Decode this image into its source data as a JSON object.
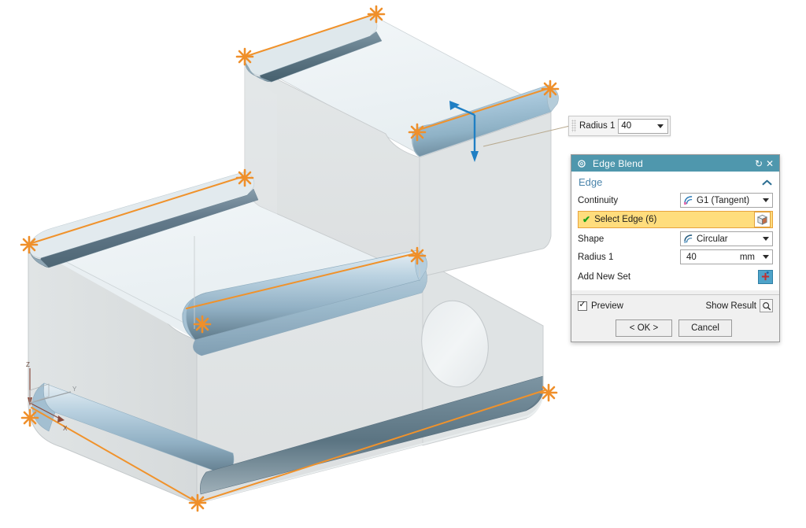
{
  "app": {
    "kind": "cad-modeling-viewport"
  },
  "float_input": {
    "label": "Radius 1",
    "value": "40",
    "dropdown_icon": "chevron-down-icon",
    "grip_icon": "drag-grip-icon"
  },
  "dialog": {
    "title": "Edge Blend",
    "title_icon": "gear-icon",
    "reset_icon": "reset-icon",
    "reset_glyph": "↻",
    "close_icon": "close-icon",
    "close_glyph": "✕",
    "group": {
      "title": "Edge",
      "collapse_icon": "chevron-up-icon"
    },
    "fields": {
      "continuity_label": "Continuity",
      "continuity_value": "G1 (Tangent)",
      "continuity_icon": "curve-continuity-icon",
      "select_edge_label": "Select Edge (6)",
      "select_edge_check": "✔",
      "select_edge_icon": "cube-select-icon",
      "shape_label": "Shape",
      "shape_value": "Circular",
      "shape_icon": "arc-shape-icon",
      "radius_label": "Radius 1",
      "radius_value": "40",
      "radius_unit": "mm",
      "add_new_set_label": "Add New Set",
      "add_new_set_icon": "add-plus-icon"
    },
    "footer": {
      "preview_label": "Preview",
      "preview_checked": "✓",
      "show_result_label": "Show Result",
      "show_result_icon": "magnifier-icon",
      "ok_label": "< OK >",
      "cancel_label": "Cancel"
    }
  },
  "viewport": {
    "triad": {
      "z_label": "Z",
      "x_label": "X",
      "y_label": "Y"
    },
    "colors": {
      "highlight_edge": "#f0922b",
      "blend_surface": "#9fc2d6",
      "face_light": "#eef3f6",
      "face_mid": "#dfe3e4",
      "face_dark": "#5c7281",
      "handle_arrow": "#1f7fc4",
      "dialog_title_bar": "#4f97ad",
      "select_row_bg": "#ffdd7d"
    },
    "selected_edge_count": "6"
  }
}
